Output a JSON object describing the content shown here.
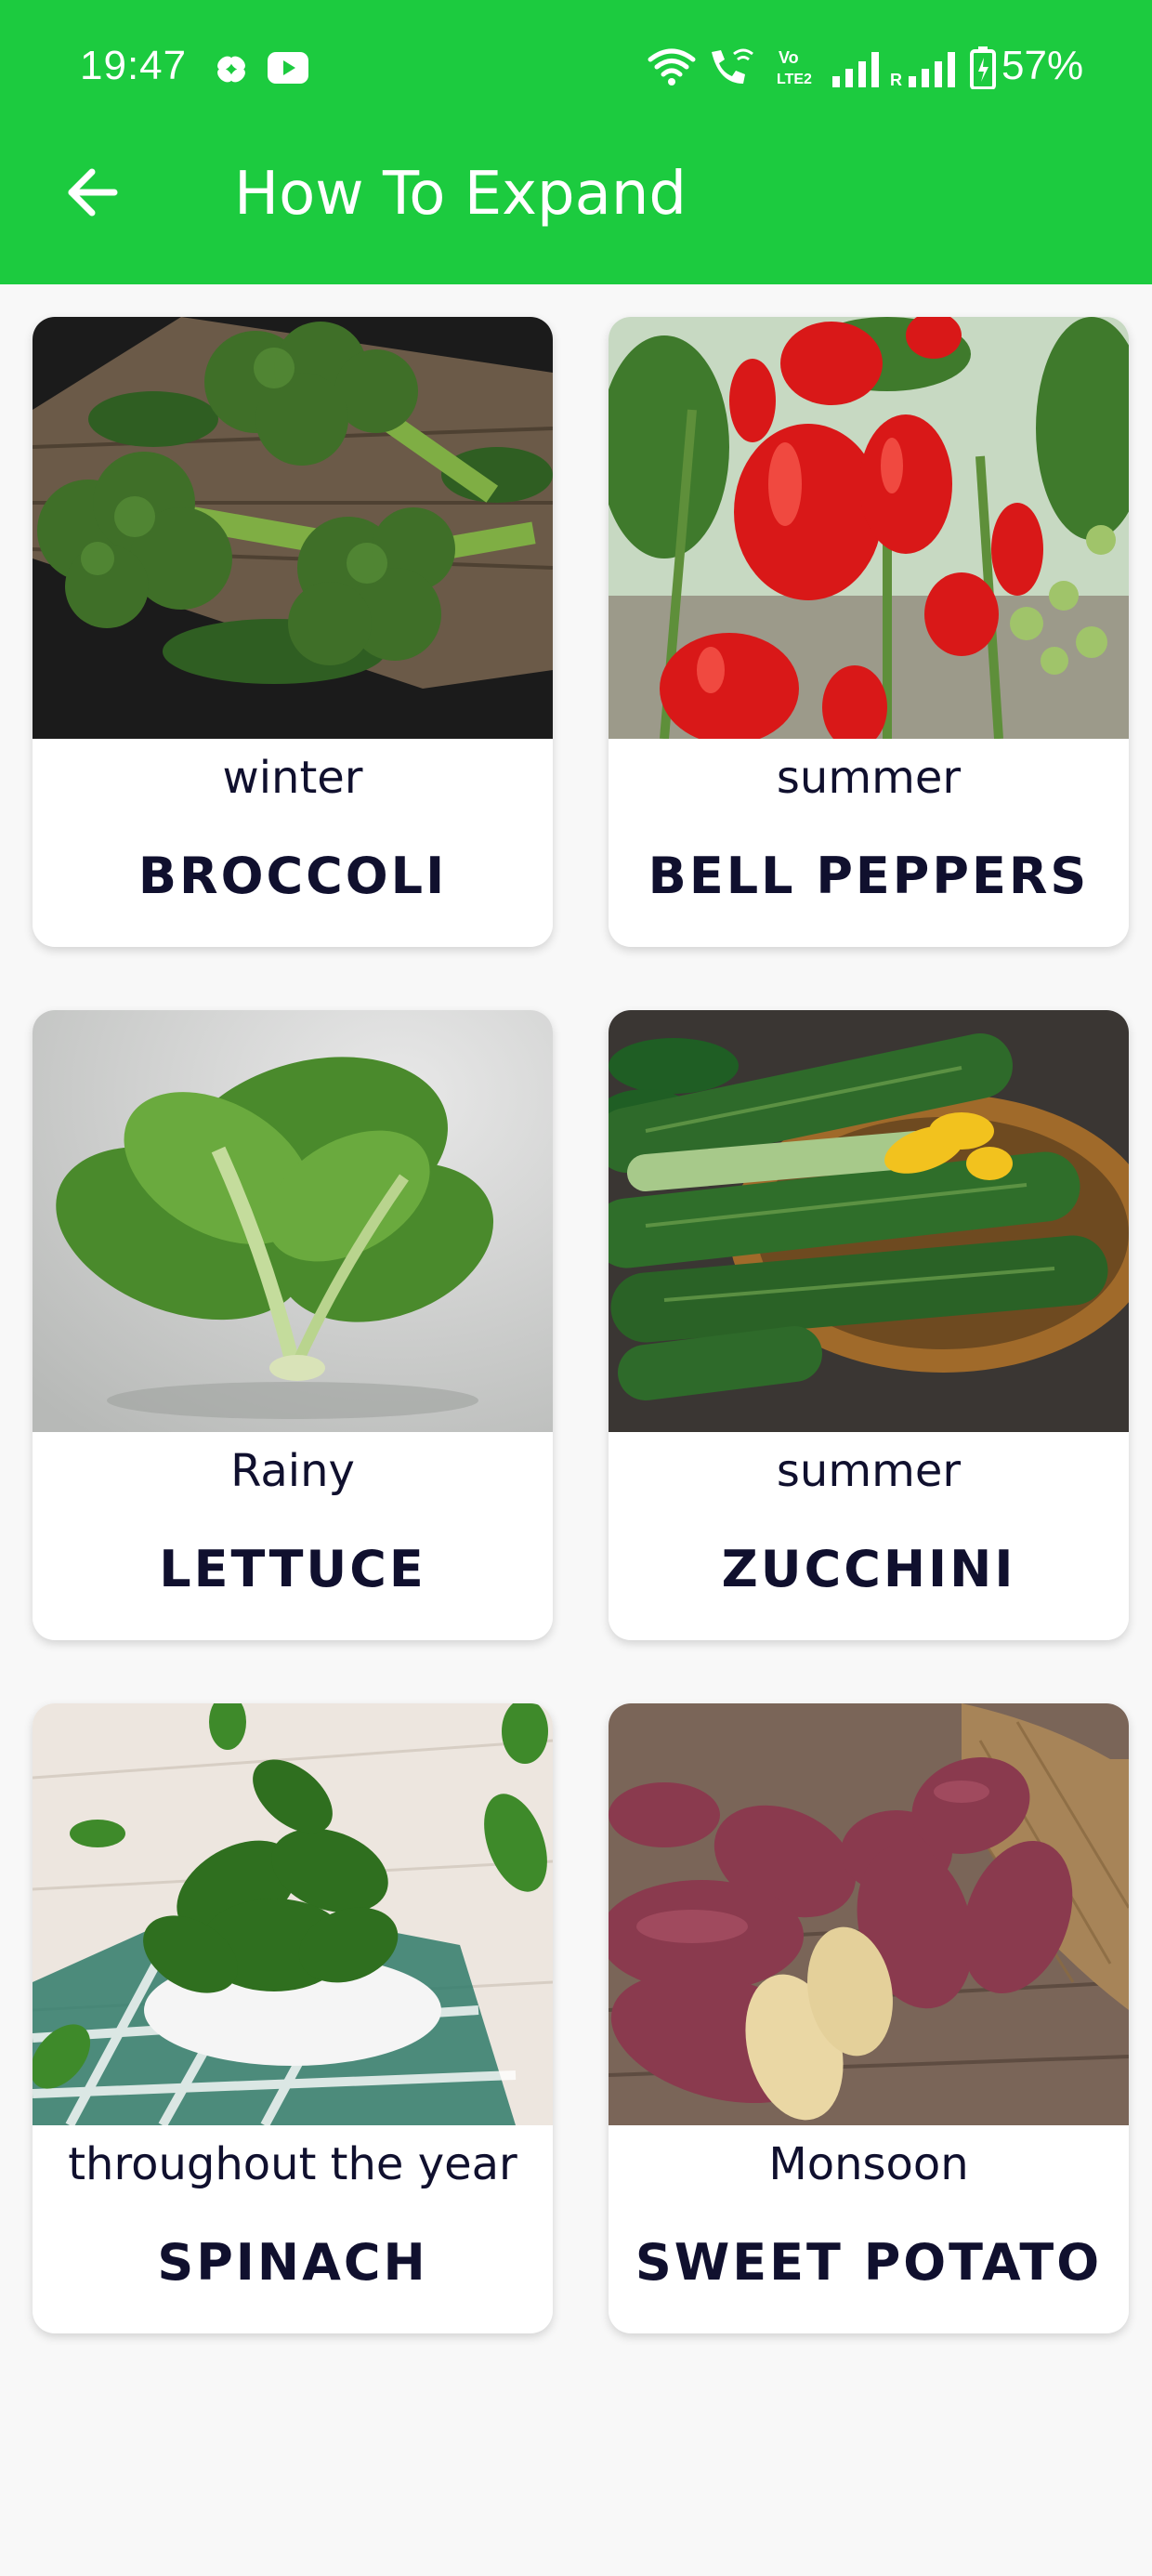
{
  "status_bar": {
    "time": "19:47",
    "battery_percent": "57%",
    "icons": [
      "pinwheel-icon",
      "youtube-icon",
      "wifi-icon",
      "wifi-call-icon",
      "volte-icon",
      "signal-icon",
      "roaming-signal-icon",
      "battery-icon"
    ]
  },
  "app_bar": {
    "title": "How To Expand",
    "back_icon": "arrow-left-icon"
  },
  "colors": {
    "app_bar": "#1ccb3f",
    "background": "#f8f8f8",
    "card_text": "#10102e"
  },
  "cards": [
    {
      "season": "winter",
      "name": "BROCCOLI",
      "image": "broccoli-photo"
    },
    {
      "season": "summer",
      "name": "BELL PEPPERS",
      "image": "bell-peppers-photo"
    },
    {
      "season": "Rainy",
      "name": "LETTUCE",
      "image": "lettuce-photo"
    },
    {
      "season": "summer",
      "name": "ZUCCHINI",
      "image": "zucchini-photo"
    },
    {
      "season": "throughout the year",
      "name": "SPINACH",
      "image": "spinach-photo"
    },
    {
      "season": "Monsoon",
      "name": "SWEET POTATO",
      "image": "sweet-potato-photo"
    }
  ]
}
